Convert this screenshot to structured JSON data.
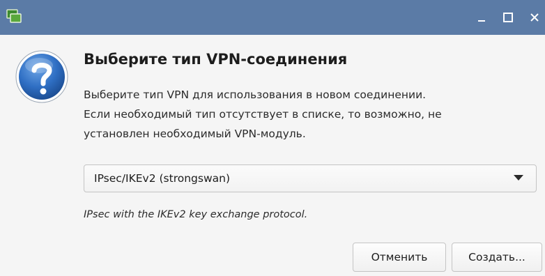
{
  "window": {
    "title_bar_color": "#5b7ba6",
    "controls": [
      "minimize-icon",
      "maximize-icon",
      "close-icon"
    ]
  },
  "dialog": {
    "icon": "question-icon",
    "title": "Выберите тип VPN-соединения",
    "description_lines": [
      "Выберите тип VPN для использования в новом соединении.",
      "Если необходимый тип отсутствует в списке, то возможно, не",
      "установлен необходимый VPN-модуль."
    ]
  },
  "vpn_type_select": {
    "selected": "IPsec/IKEv2 (strongswan)",
    "hint": "IPsec with the IKEv2 key exchange protocol."
  },
  "buttons": {
    "cancel_label": "Отменить",
    "create_label": "Создать..."
  }
}
